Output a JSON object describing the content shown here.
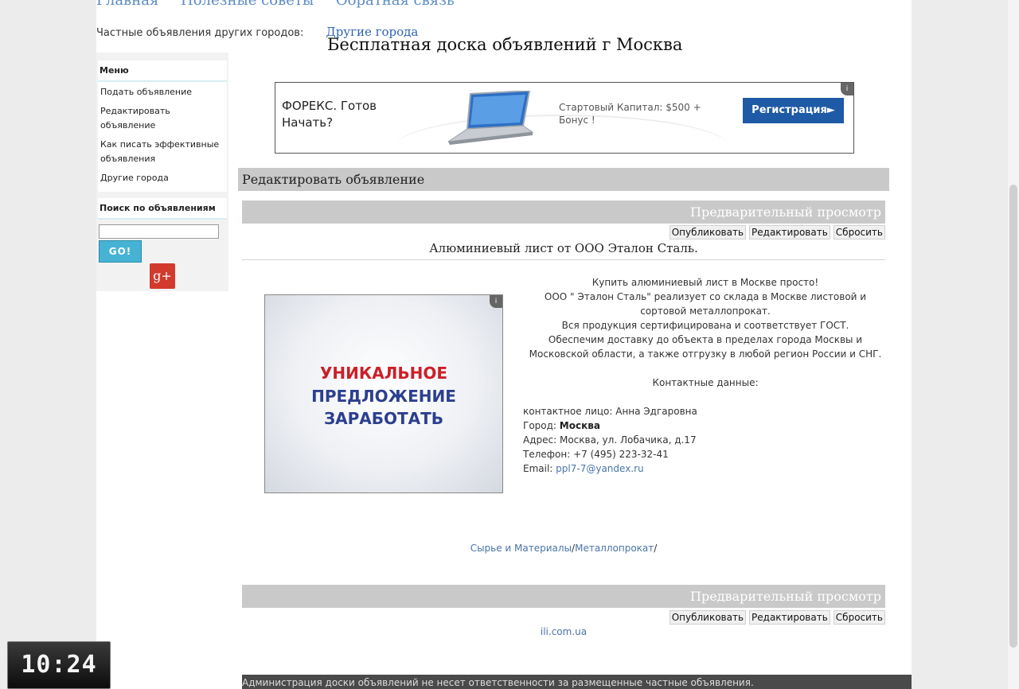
{
  "nav": {
    "items": [
      "Главная",
      "Полезные советы",
      "Обратная связь"
    ]
  },
  "others": {
    "label": "Частные объявления других городов:",
    "link": "Другие города"
  },
  "site_title": "Бесплатная доска объявлений г Москва",
  "sidebar": {
    "menu_title": "Меню",
    "items": [
      "Подать объявление",
      "Редактировать объявление",
      "Как писать эффективные объявления",
      "Другие города"
    ],
    "search_title": "Поиск по объявлениям",
    "search_value": "",
    "go_label": "GO!",
    "gplus_label": "g+"
  },
  "banner": {
    "text": "ФОРЕКС. Готов Начать?",
    "side_text": "Стартовый Капитал: $500 + Бонус !",
    "button": "Регистрация►",
    "info": "i"
  },
  "section_title": "Редактировать объявление",
  "preview_label": "Предварительный просмотр",
  "actions": {
    "publish": "Опубликовать",
    "edit": "Редактировать",
    "reset": "Сбросить"
  },
  "ad": {
    "title": "Алюминиевый лист от ООО Эталон Сталь.",
    "lines": [
      "Купить алюминиевый лист в Москве просто!",
      "ООО \" Эталон Сталь\" реализует со склада в Москве листовой и сортовой металлопрокат.",
      "Вся продукция сертифицирована и соответствует ГОСТ.",
      "Обеспечим доставку до объекта в пределах города Москвы и Московской области, а также отгрузку в любой регион России и СНГ."
    ],
    "contacts_title": "Контактные данные:",
    "contact_person": "контактное лицо: Анна Эдгаровна",
    "city_label": "Город:",
    "city": "Москва",
    "address": "Адрес: Москва, ул. Лобачика, д.17",
    "phone": "Телефон: +7 (495) 223-32-41",
    "email_label": "Email:",
    "email": "ppl7-7@yandex.ru"
  },
  "square_ad": {
    "line1": "УНИКАЛЬНОЕ",
    "line2": "ПРЕДЛОЖЕНИЕ",
    "line3": "ЗАРАБОТАТЬ",
    "info": "i"
  },
  "categories": {
    "cat1": "Сырье и Материалы",
    "sep1": "/",
    "cat2": "Металлопрокат",
    "sep2": "/"
  },
  "site_link": "ili.com.ua",
  "footer": "Администрация доски объявлений не несет ответственности за размещенные частные объявления.",
  "clock": "10:24",
  "colors": {
    "link": "#4a74a8",
    "header_bar": "#c9c9c9",
    "go_button": "#46b3d4",
    "banner_button": "#1f5aa6"
  }
}
